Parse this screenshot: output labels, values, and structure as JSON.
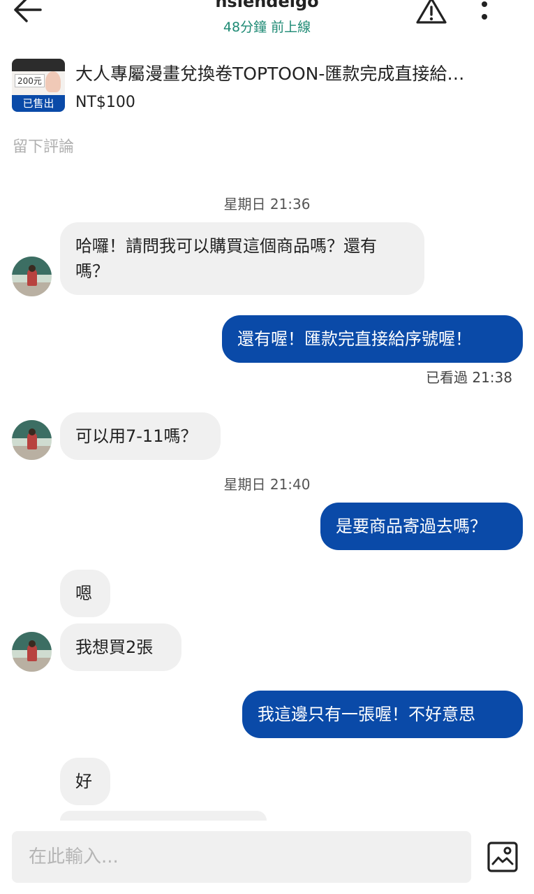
{
  "header": {
    "name": "hsiendeigo",
    "status": "48分鐘 前上線"
  },
  "product": {
    "thumbnail_price": "200元",
    "sold_badge": "已售出",
    "title": "大人專屬漫畫兌換卷TOPTOON-匯款完成直接給…",
    "price": "NT$100"
  },
  "review_link": "留下評論",
  "chat": {
    "timestamps": [
      "星期日 21:36",
      "星期日 21:40"
    ],
    "messages": [
      {
        "side": "in",
        "text": "哈囉！請問我可以購買這個商品嗎？還有嗎？"
      },
      {
        "side": "out",
        "text": "還有喔！匯款完直接給序號喔！"
      },
      {
        "side": "in",
        "text": "可以用7-11嗎？"
      },
      {
        "side": "out",
        "text": "是要商品寄過去嗎？"
      },
      {
        "side": "in",
        "text": "嗯"
      },
      {
        "side": "in",
        "text": "我想買2張"
      },
      {
        "side": "out",
        "text": "我這邊只有一張喔！不好意思"
      },
      {
        "side": "in",
        "text": "好"
      }
    ],
    "seen_label": "已看過 21:38"
  },
  "composer": {
    "placeholder": "在此輸入..."
  },
  "icons": {
    "back": "arrow-left-icon",
    "warning": "warning-triangle-icon",
    "more": "more-vertical-icon",
    "image": "image-upload-icon"
  },
  "colors": {
    "accent": "#0a4aa8",
    "online_status": "#1e8a74",
    "incoming_bubble": "#f0f0f0"
  }
}
